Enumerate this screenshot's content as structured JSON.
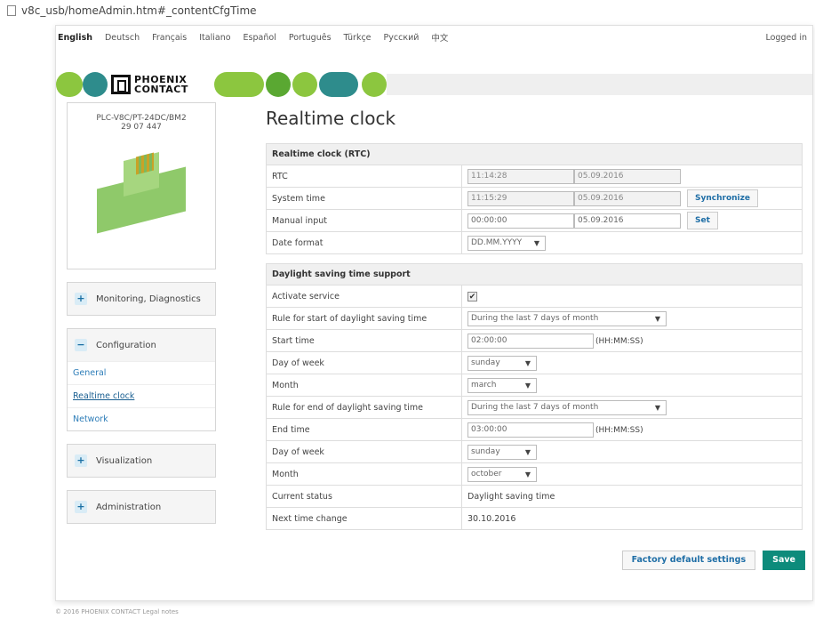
{
  "url": "v8c_usb/homeAdmin.htm#_contentCfgTime",
  "languages": [
    "English",
    "Deutsch",
    "Français",
    "Italiano",
    "Español",
    "Português",
    "Türkçe",
    "Русский",
    "中文"
  ],
  "logged_in": "Logged in",
  "logo": {
    "line1": "PHOENIX",
    "line2": "CONTACT"
  },
  "device": {
    "model": "PLC-V8C/PT-24DC/BM2",
    "number": "29 07 447"
  },
  "nav": {
    "monitoring": "Monitoring, Diagnostics",
    "configuration": "Configuration",
    "config_items": [
      "General",
      "Realtime clock",
      "Network"
    ],
    "visualization": "Visualization",
    "administration": "Administration"
  },
  "title": "Realtime clock",
  "rtc_section": {
    "heading": "Realtime clock (RTC)",
    "rtc_label": "RTC",
    "rtc_time": "11:14:28",
    "rtc_date": "05.09.2016",
    "system_label": "System time",
    "system_time": "11:15:29",
    "system_date": "05.09.2016",
    "sync_button": "Synchronize",
    "manual_label": "Manual input",
    "manual_time": "00:00:00",
    "manual_date": "05.09.2016",
    "set_button": "Set",
    "format_label": "Date format",
    "format_value": "DD.MM.YYYY"
  },
  "dst_section": {
    "heading": "Daylight saving time support",
    "activate_label": "Activate service",
    "activate_mark": "✔",
    "start_rule_label": "Rule for start of daylight saving time",
    "start_rule_value": "During the last 7 days of month",
    "start_time_label": "Start time",
    "start_time_value": "02:00:00",
    "time_hint": "(HH:MM:SS)",
    "dow_label": "Day of week",
    "start_dow": "sunday",
    "month_label": "Month",
    "start_month": "march",
    "end_rule_label": "Rule for end of daylight saving time",
    "end_rule_value": "During the last 7 days of month",
    "end_time_label": "End time",
    "end_time_value": "03:00:00",
    "end_dow": "sunday",
    "end_month": "october",
    "status_label": "Current status",
    "status_value": "Daylight saving time",
    "next_label": "Next time change",
    "next_value": "30.10.2016"
  },
  "buttons": {
    "factory": "Factory default settings",
    "save": "Save"
  },
  "footer": "© 2016 PHOENIX CONTACT    Legal notes",
  "colors": {
    "green_light": "#8cc63f",
    "green_dark": "#5aa832",
    "teal": "#2e8c8c",
    "save": "#0d8b7b",
    "link": "#2d7db8"
  }
}
